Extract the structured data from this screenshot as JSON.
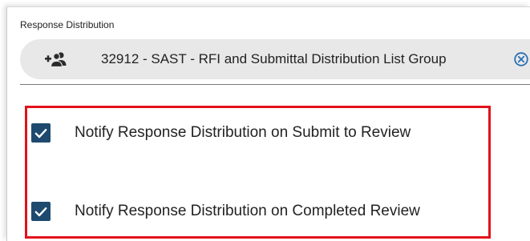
{
  "section": {
    "label": "Response Distribution"
  },
  "distribution_chip": {
    "icon": "add-group-icon",
    "text": "32912 - SAST - RFI and Submittal Distribution List Group",
    "remove_icon": "close-circle-icon"
  },
  "options": [
    {
      "label": "Notify Response Distribution on Submit to Review",
      "checked": true
    },
    {
      "label": "Notify Response Distribution on Completed Review",
      "checked": true
    }
  ],
  "colors": {
    "checkbox_fill": "#1d4a6e",
    "highlight_border": "#e3111b",
    "chip_background": "#e8e8e8",
    "close_icon": "#2a6fb5"
  }
}
